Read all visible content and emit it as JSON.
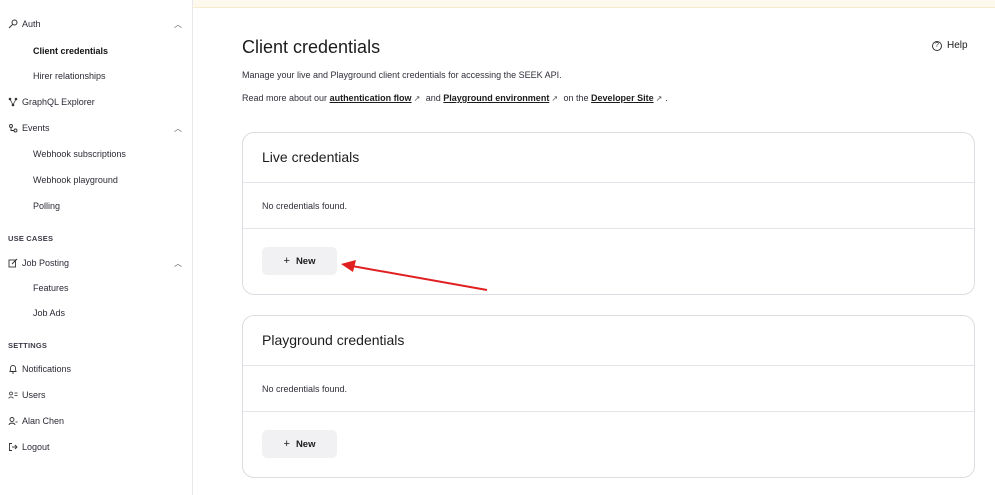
{
  "sidebar": {
    "auth": {
      "label": "Auth",
      "icon": "key-icon"
    },
    "auth_items": [
      "Client credentials",
      "Hirer relationships"
    ],
    "graphql": {
      "label": "GraphQL Explorer"
    },
    "events": {
      "label": "Events"
    },
    "events_items": [
      "Webhook subscriptions",
      "Webhook playground",
      "Polling"
    ],
    "use_cases_heading": "USE CASES",
    "job_posting": {
      "label": "Job Posting"
    },
    "job_posting_items": [
      "Features",
      "Job Ads"
    ],
    "settings_heading": "SETTINGS",
    "notifications": {
      "label": "Notifications"
    },
    "users": {
      "label": "Users"
    },
    "account": {
      "label": "Alan Chen"
    },
    "logout": {
      "label": "Logout"
    }
  },
  "main": {
    "title": "Client credentials",
    "help_label": "Help",
    "description": "Manage your live and Playground client credentials for accessing the SEEK API.",
    "read_more_prefix": "Read more about our ",
    "auth_flow_link": "authentication flow",
    "and_text": " and ",
    "playground_env_link": "Playground environment",
    "on_the_text": " on the ",
    "developer_site_link": "Developer Site",
    "period": "."
  },
  "live_card": {
    "title": "Live credentials",
    "empty_text": "No credentials found.",
    "new_button": "New"
  },
  "playground_card": {
    "title": "Playground credentials",
    "empty_text": "No credentials found.",
    "new_button": "New"
  },
  "colors": {
    "annotation_arrow": "#e02020",
    "top_stripe": "#fdf9ec"
  }
}
